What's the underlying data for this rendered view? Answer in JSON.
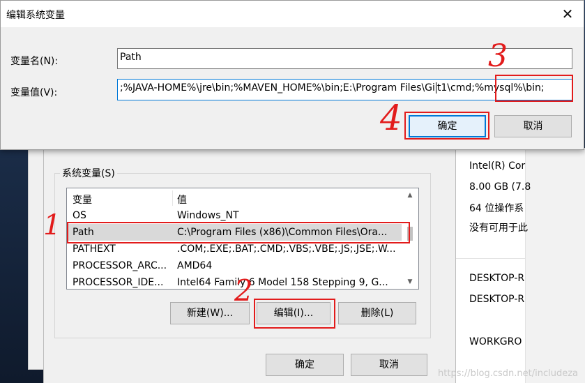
{
  "dialog": {
    "title": "编辑系统变量",
    "close_glyph": "✕",
    "name_label": "变量名(N):",
    "name_value": "Path",
    "value_label": "变量值(V):",
    "value_text_a": ";%JAVA-HOME%\\jre\\bin;%MAVEN_HOME%\\bin;E:\\Program Files\\Gi",
    "value_text_b": "t1\\cmd;%mysql%\\bin;",
    "ok_label": "确定",
    "cancel_label": "取消"
  },
  "env_dialog": {
    "group_title": "系统变量(S)",
    "columns": [
      "变量",
      "值"
    ],
    "rows": [
      {
        "name": "OS",
        "value": "Windows_NT"
      },
      {
        "name": "Path",
        "value": "C:\\Program Files (x86)\\Common Files\\Ora..."
      },
      {
        "name": "PATHEXT",
        "value": ".COM;.EXE;.BAT;.CMD;.VBS;.VBE;.JS;.JSE;.W..."
      },
      {
        "name": "PROCESSOR_ARC...",
        "value": "AMD64"
      },
      {
        "name": "PROCESSOR_IDE...",
        "value": "Intel64 Family 6 Model 158 Stepping 9, G..."
      }
    ],
    "new_label": "新建(W)...",
    "edit_label": "编辑(I)...",
    "delete_label": "删除(L)",
    "ok_label": "确定",
    "cancel_label": "取消"
  },
  "system_info": {
    "lines": [
      "Intel(R) Cor",
      "8.00 GB (7.8",
      "64 位操作系",
      "没有可用于此",
      "DESKTOP-R",
      "DESKTOP-R",
      "WORKGRO"
    ]
  },
  "annotations": [
    "1",
    "2",
    "3",
    "4"
  ],
  "watermark": "https://blog.csdn.net/includeza",
  "colors": {
    "annotation": "#e21b1b",
    "focus": "#0078d7"
  }
}
